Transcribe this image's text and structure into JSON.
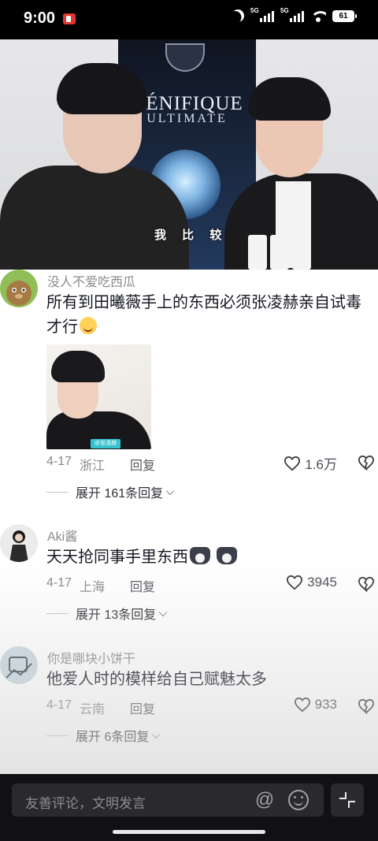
{
  "status_bar": {
    "time": "9:00",
    "network_1": "5G",
    "network_2": "5G",
    "battery": "61"
  },
  "video": {
    "poster_title": "GÉNIFIQUE",
    "poster_subtitle": "ULTIMATE",
    "caption": "我 比 较"
  },
  "comments": [
    {
      "author": "没人不爱吃西瓜",
      "text": "所有到田曦薇手上的东西必须张凌赫亲自试毒才行",
      "emoji": "smile",
      "image_tag": "@张凌赫",
      "date": "4-17",
      "location": "浙江",
      "reply_label": "回复",
      "likes": "1.6万",
      "expand_label": "展开 161条回复"
    },
    {
      "author": "Aki酱",
      "text": "天天抢同事手里东西",
      "emoji": "husky",
      "date": "4-17",
      "location": "上海",
      "reply_label": "回复",
      "likes": "3945",
      "expand_label": "展开 13条回复"
    },
    {
      "author": "你是哪块小饼干",
      "text": "他爱人时的模样给自己赋魅太多",
      "date": "4-17",
      "location": "云南",
      "reply_label": "回复",
      "likes": "933",
      "expand_label": "展开 6条回复"
    }
  ],
  "input_bar": {
    "placeholder": "友善评论，文明发言"
  },
  "icons": {
    "heart": "heart-outline-icon",
    "dislike": "broken-heart-icon",
    "at": "at-icon",
    "emoji": "emoji-icon",
    "collapse": "collapse-icon"
  }
}
